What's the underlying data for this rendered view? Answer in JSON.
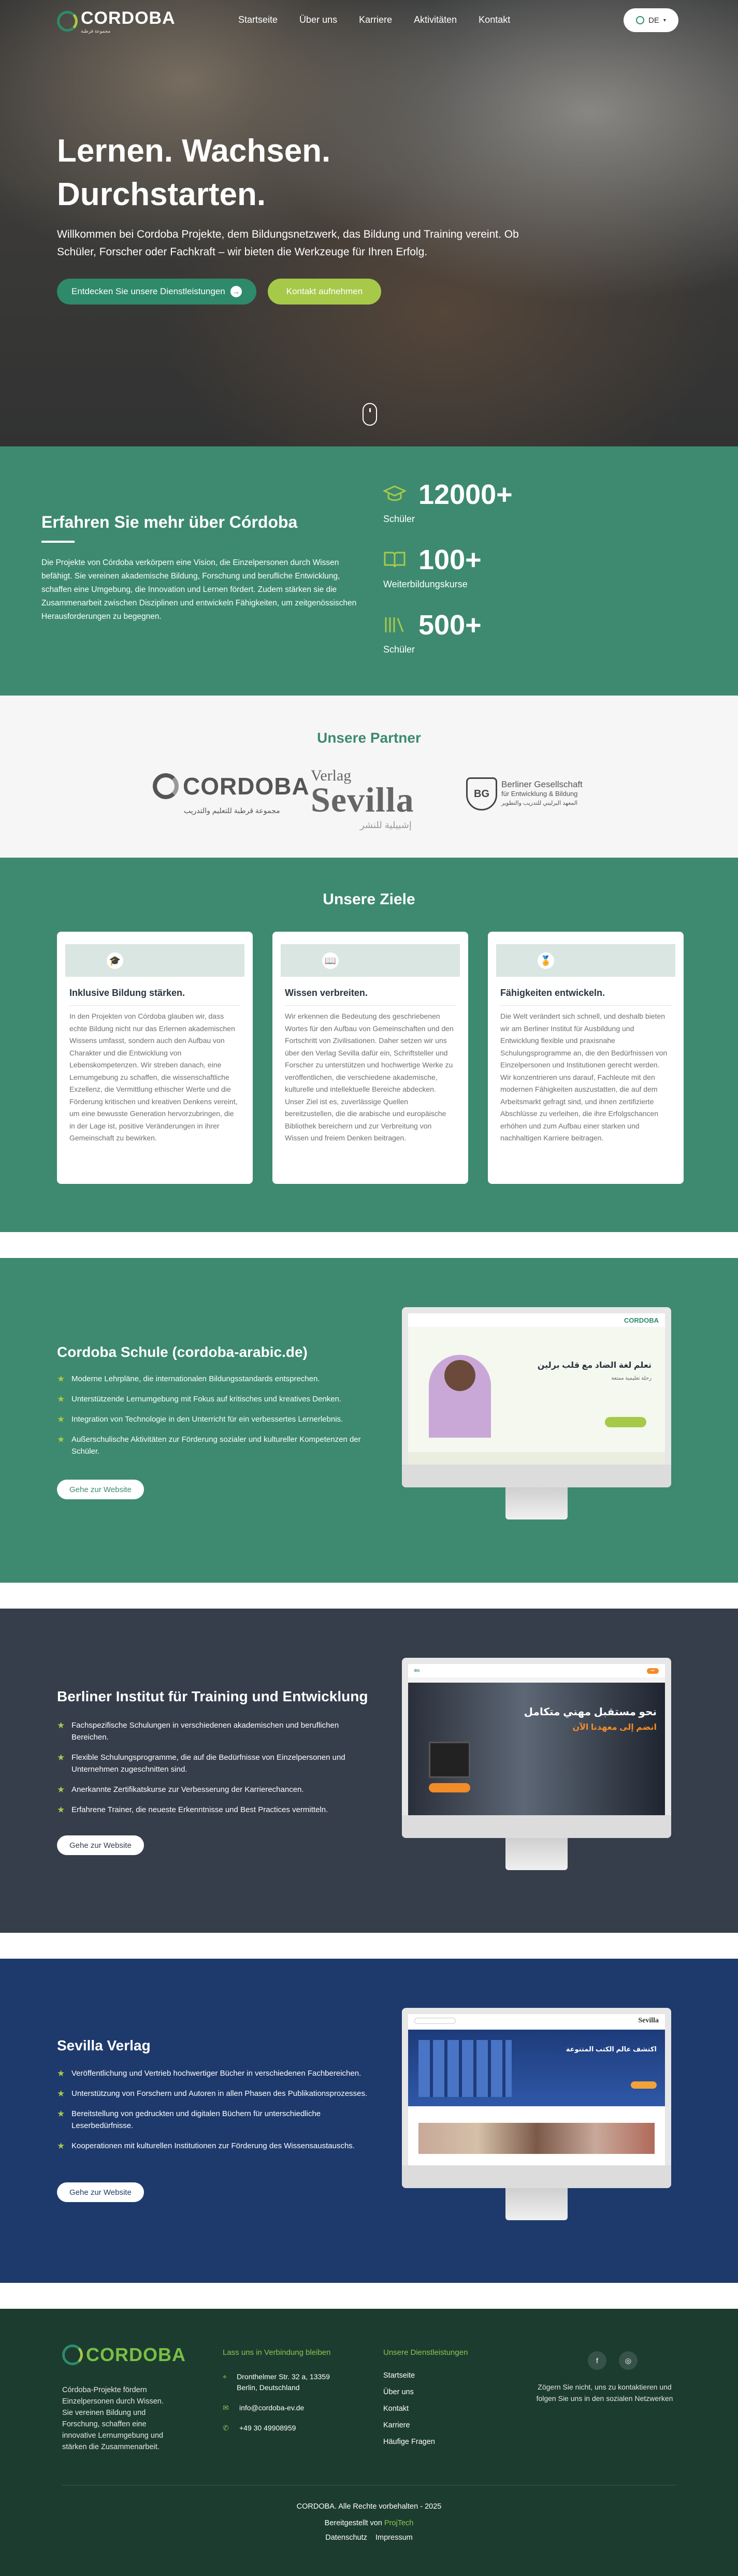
{
  "header": {
    "logo_text": "CORDOBA",
    "logo_subtitle": "مجموعة قرطبة",
    "nav": [
      "Startseite",
      "Über uns",
      "Karriere",
      "Aktivitäten",
      "Kontakt"
    ],
    "language": "DE"
  },
  "hero": {
    "title_line1": "Lernen. Wachsen.",
    "title_line2": "Durchstarten.",
    "text": "Willkommen bei Cordoba Projekte, dem Bildungsnetzwerk, das Bildung und Training vereint. Ob Schüler, Forscher oder Fachkraft – wir bieten die Werkzeuge für Ihren Erfolg.",
    "btn_primary": "Entdecken Sie unsere Dienstleistungen",
    "btn_secondary": "Kontakt aufnehmen"
  },
  "about": {
    "title": "Erfahren Sie mehr über Córdoba",
    "text": "Die Projekte von Córdoba verkörpern eine Vision, die Einzelpersonen durch Wissen befähigt. Sie vereinen akademische Bildung, Forschung und berufliche Entwicklung, schaffen eine Umgebung, die Innovation und Lernen fördert. Zudem stärken sie die Zusammenarbeit zwischen Disziplinen und entwickeln Fähigkeiten, um zeitgenössischen Herausforderungen zu begegnen.",
    "stats": [
      {
        "number": "12000+",
        "label": "Schüler",
        "icon": "graduation-cap-icon"
      },
      {
        "number": "100+",
        "label": "Weiterbildungskurse",
        "icon": "open-book-icon"
      },
      {
        "number": "500+",
        "label": "Schüler",
        "icon": "books-icon"
      }
    ]
  },
  "partners": {
    "title": "Unsere Partner",
    "cordoba_name": "CORDOBA",
    "cordoba_sub": "مجموعة قرطبة للتعليم والتدريب",
    "sevilla_top": "Verlag",
    "sevilla_name": "Sevilla",
    "sevilla_sub": "إشبيلية للنشر",
    "berlin_badge": "BG",
    "berlin_line1": "Berliner Gesellschaft",
    "berlin_line2": "für Entwicklung & Bildung",
    "berlin_line3": "المعهد البرليني للتدريب والتطوير"
  },
  "goals": {
    "title": "Unsere Ziele",
    "cards": [
      {
        "title": "Inklusive Bildung stärken.",
        "icon": "graduation-cap-icon",
        "text": "In den Projekten von Córdoba glauben wir, dass echte Bildung nicht nur das Erlernen akademischen Wissens umfasst, sondern auch den Aufbau von Charakter und die Entwicklung von Lebenskompetenzen. Wir streben danach, eine Lernumgebung zu schaffen, die wissenschaftliche Exzellenz, die Vermittlung ethischer Werte und die Förderung kritischen und kreativen Denkens vereint, um eine bewusste Generation hervorzubringen, die in der Lage ist, positive Veränderungen in ihrer Gemeinschaft zu bewirken."
      },
      {
        "title": "Wissen verbreiten.",
        "icon": "open-book-icon",
        "text": "Wir erkennen die Bedeutung des geschriebenen Wortes für den Aufbau von Gemeinschaften und den Fortschritt von Zivilisationen. Daher setzen wir uns über den Verlag Sevilla dafür ein, Schriftsteller und Forscher zu unterstützen und hochwertige Werke zu veröffentlichen, die verschiedene akademische, kulturelle und intellektuelle Bereiche abdecken. Unser Ziel ist es, zuverlässige Quellen bereitzustellen, die die arabische und europäische Bibliothek bereichern und zur Verbreitung von Wissen und freiem Denken beitragen."
      },
      {
        "title": "Fähigkeiten entwickeln.",
        "icon": "award-icon",
        "text": "Die Welt verändert sich schnell, und deshalb bieten wir am Berliner Institut für Ausbildung und Entwicklung flexible und praxisnahe Schulungsprogramme an, die den Bedürfnissen von Einzelpersonen und Institutionen gerecht werden. Wir konzentrieren uns darauf, Fachleute mit den modernen Fähigkeiten auszustatten, die auf dem Arbeitsmarkt gefragt sind, und ihnen zertifizierte Abschlüsse zu verleihen, die ihre Erfolgschancen erhöhen und zum Aufbau einer starken und nachhaltigen Karriere beitragen."
      }
    ]
  },
  "projects": [
    {
      "title": "Cordoba Schule (cordoba-arabic.de)",
      "bg": "#3d8a70",
      "items": [
        "Moderne Lehrpläne, die internationalen Bildungsstandards entsprechen.",
        "Unterstützende Lernumgebung mit Fokus auf kritisches und kreatives Denken.",
        "Integration von Technologie in den Unterricht für ein verbessertes Lernerlebnis.",
        "Außerschulische Aktivitäten zur Förderung sozialer und kultureller Kompetenzen der Schüler."
      ],
      "button": "Gehe zur Website",
      "screen_headline": "تعلم لغة الضاد مع قلب برلين",
      "screen_sub": "رحلة تعليمية ممتعة"
    },
    {
      "title": "Berliner Institut für Training und Entwicklung",
      "bg": "#363d4b",
      "items": [
        "Fachspezifische Schulungen in verschiedenen akademischen und beruflichen Bereichen.",
        "Flexible Schulungsprogramme, die auf die Bedürfnisse von Einzelpersonen und Unternehmen zugeschnitten sind.",
        "Anerkannte Zertifikatskurse zur Verbesserung der Karrierechancen.",
        "Erfahrene Trainer, die neueste Erkenntnisse und Best Practices vermitteln."
      ],
      "button": "Gehe zur Website",
      "screen_headline": "نحو مستقبل مهني متكامل",
      "screen_sub": "انضم إلى معهدنا الآن"
    },
    {
      "title": "Sevilla Verlag",
      "bg": "#1e3a6c",
      "items": [
        "Veröffentlichung und Vertrieb hochwertiger Bücher in verschiedenen Fachbereichen.",
        "Unterstützung von Forschern und Autoren in allen Phasen des Publikationsprozesses.",
        "Bereitstellung von gedruckten und digitalen Büchern für unterschiedliche Leserbedürfnisse.",
        "Kooperationen mit kulturellen Institutionen zur Förderung des Wissensaustauschs."
      ],
      "button": "Gehe zur Website",
      "screen_headline": "اكتشف عالم الكتب المتنوعة",
      "screen_sub": "Sevilla"
    }
  ],
  "footer": {
    "logo_text": "CORDOBA",
    "intro": "Córdoba-Projekte fördern Einzelpersonen durch Wissen. Sie vereinen Bildung und Forschung, schaffen eine innovative Lernumgebung und stärken die Zusammenarbeit.",
    "contact_title": "Lass uns in Verbindung bleiben",
    "address": "Dronthelmer Str. 32 a, 13359 Berlin, Deutschland",
    "email": "info@cordoba-ev.de",
    "phone": "+49 30 49908959",
    "services_title": "Unsere Dienstleistungen",
    "links": [
      "Startseite",
      "Über uns",
      "Kontakt",
      "Karriere",
      "Häufige Fragen"
    ],
    "follow_text": "Zögern Sie nicht, uns zu kontaktieren und folgen Sie uns in den sozialen Netzwerken",
    "copyright": "CORDOBA. Alle Rechte vorbehalten - 2025",
    "developed_by_prefix": "Bereitgestellt von",
    "developed_by": "ProjTech",
    "legal": [
      "Datenschutz",
      "Impressum"
    ]
  },
  "colors": {
    "primary_green": "#3d8a70",
    "lime": "#a7c94a",
    "institute_bg": "#363d4b",
    "verlag_bg": "#1e3a6c",
    "footer_bg": "#1c3c30"
  }
}
